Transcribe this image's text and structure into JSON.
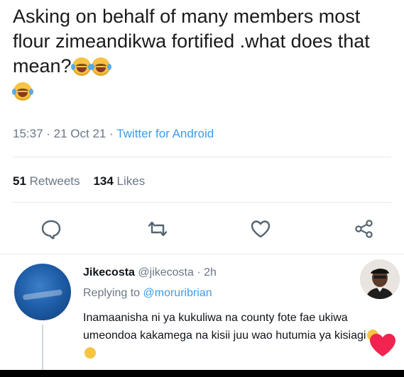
{
  "tweet": {
    "text": "Asking on behalf of many members most flour zimeandikwa fortified .what does that mean?",
    "time": "15:37",
    "date": "21 Oct 21",
    "source": "Twitter for Android",
    "sep": " · "
  },
  "stats": {
    "retweets_count": "51",
    "retweets_label": "Retweets",
    "likes_count": "134",
    "likes_label": "Likes"
  },
  "icons": {
    "reply": "comment-icon",
    "retweet": "retweet-icon",
    "like": "heart-outline-icon",
    "share": "share-icon"
  },
  "reply": {
    "display_name": "Jikecosta",
    "handle": "@jikecosta",
    "age": "2h",
    "replying_prefix": "Replying to",
    "replying_to": "@moruribrian",
    "body": "Inamaanisha ni ya kukuliwa na county fote fae ukiwa umeondoa kakamega na kisii juu wao hutumia ya kisiagi"
  },
  "colors": {
    "link": "#3d9be9",
    "muted": "#6b7785",
    "heart": "#f0244f"
  }
}
